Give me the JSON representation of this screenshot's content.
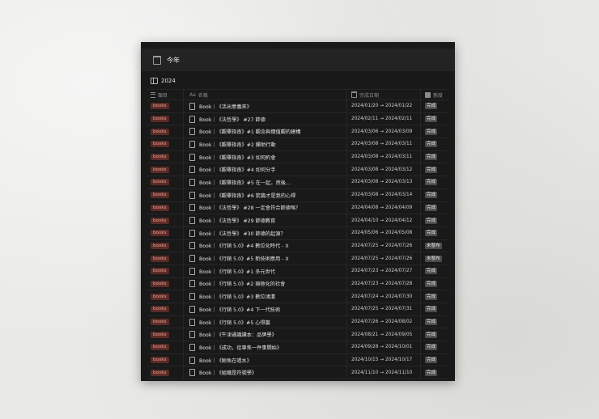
{
  "header": {
    "title": "今年"
  },
  "view": {
    "tab_label": "2024"
  },
  "columns": {
    "category": "類目",
    "name": "名稱",
    "date": "完成日期",
    "status": "態度"
  },
  "rows": [
    {
      "tag": "books",
      "name": "Book｜《活出意義來》",
      "date": "2024/01/20 → 2024/01/22",
      "status": "完成"
    },
    {
      "tag": "books",
      "name": "Book｜《法哲學》 #27 節德",
      "date": "2024/02/11 → 2024/02/11",
      "status": "完成"
    },
    {
      "tag": "books",
      "name": "Book｜《觀畢指南》#1 觀念與價值觀的建構",
      "date": "2024/03/06 → 2024/03/09",
      "status": "完成"
    },
    {
      "tag": "books",
      "name": "Book｜《觀畢指南》#2 攔助行動",
      "date": "2024/03/08 → 2024/03/11",
      "status": "完成"
    },
    {
      "tag": "books",
      "name": "Book｜《觀畢指南》#3 如何約會",
      "date": "2024/03/08 → 2024/03/11",
      "status": "完成"
    },
    {
      "tag": "books",
      "name": "Book｜《觀畢指南》#4 如何分手",
      "date": "2024/03/08 → 2024/03/12",
      "status": "完成"
    },
    {
      "tag": "books",
      "name": "Book｜《觀畢指南》#5 在一起，然後...",
      "date": "2024/03/08 → 2024/03/13",
      "status": "完成"
    },
    {
      "tag": "books",
      "name": "Book｜《觀畢指南》#6 箭篇才是我的心得",
      "date": "2024/03/08 → 2024/03/14",
      "status": "完成"
    },
    {
      "tag": "books",
      "name": "Book｜《法哲學》 #28 一定會符合節德嗎？",
      "date": "2024/04/08 → 2024/04/09",
      "status": "完成"
    },
    {
      "tag": "books",
      "name": "Book｜《法哲學》 #29 節德教育",
      "date": "2024/04/10 → 2024/04/12",
      "status": "完成"
    },
    {
      "tag": "books",
      "name": "Book｜《法哲學》 #30 節德的起源？",
      "date": "2024/05/06 → 2024/05/08",
      "status": "完成"
    },
    {
      "tag": "books",
      "name": "Book｜《行銷 5.0》#4 數位化時代 - X",
      "date": "2024/07/25 → 2024/07/26",
      "status": "未發布"
    },
    {
      "tag": "books",
      "name": "Book｜《行銷 5.0》#5 新技術應用 - X",
      "date": "2024/07/25 → 2024/07/26",
      "status": "未發布"
    },
    {
      "tag": "books",
      "name": "Book｜《行銷 5.0》#1 多元世代",
      "date": "2024/07/23 → 2024/07/27",
      "status": "完成"
    },
    {
      "tag": "books",
      "name": "Book｜《行銷 5.0》#2 兩極化的社會",
      "date": "2024/07/23 → 2024/07/28",
      "status": "完成"
    },
    {
      "tag": "books",
      "name": "Book｜《行銷 5.0》#3 數位鴻溝",
      "date": "2024/07/24 → 2024/07/30",
      "status": "完成"
    },
    {
      "tag": "books",
      "name": "Book｜《行銷 5.0》#4 下一代技術",
      "date": "2024/07/25 → 2024/07/31",
      "status": "完成"
    },
    {
      "tag": "books",
      "name": "Book｜《行銷 5.0》#5 心得篇",
      "date": "2024/07/26 → 2024/08/02",
      "status": "完成"
    },
    {
      "tag": "books",
      "name": "Book｜《牛津通識讀本：品牌學》",
      "date": "2024/08/21 → 2024/09/05",
      "status": "完成"
    },
    {
      "tag": "books",
      "name": "Book｜《成功，從專焦一件事開始》",
      "date": "2024/09/28 → 2024/10/01",
      "status": "完成"
    },
    {
      "tag": "books",
      "name": "Book｜《鯨魚在唱水》",
      "date": "2024/10/15 → 2024/10/17",
      "status": "完成"
    },
    {
      "tag": "books",
      "name": "Book｜《組織是符號學》",
      "date": "2024/11/10 → 2024/11/10",
      "status": "完成"
    }
  ],
  "colors": {
    "tag_bg": "#5c2b26",
    "tag_text": "#e3a59c",
    "status_bg": "#4a4a4a",
    "panel_bg": "#191919"
  }
}
